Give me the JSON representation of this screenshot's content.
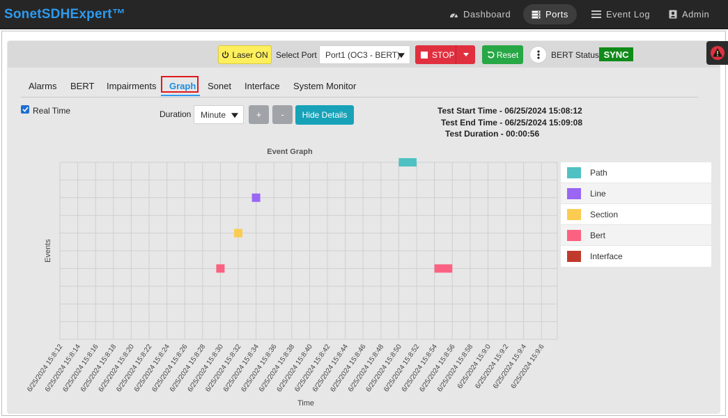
{
  "app": {
    "brand": "SonetSDHExpert™"
  },
  "nav": [
    {
      "label": "Dashboard",
      "icon": "dashboard-icon"
    },
    {
      "label": "Ports",
      "icon": "server-icon",
      "active": true
    },
    {
      "label": "Event Log",
      "icon": "list-icon"
    },
    {
      "label": "Admin",
      "icon": "user-icon"
    }
  ],
  "toolbar": {
    "laser_label": "Laser ON",
    "select_port_label": "Select Port",
    "port_value": "Port1 (OC3 - BERT)",
    "stop_label": "STOP",
    "reset_label": "Reset",
    "bert_status_label": "BERT Status",
    "bert_status_value": "SYNC"
  },
  "tabs": [
    "Alarms",
    "BERT",
    "Impairments",
    "Graph",
    "Sonet",
    "Interface",
    "System Monitor"
  ],
  "active_tab": "Graph",
  "controls": {
    "realtime_label": "Real Time",
    "realtime_checked": true,
    "duration_label": "Duration",
    "duration_value": "Minute",
    "plus_label": "+",
    "minus_label": "-",
    "hide_details_label": "Hide Details"
  },
  "details": {
    "start": "Test Start Time - 06/25/2024 15:08:12",
    "end": "Test End Time - 06/25/2024 15:09:08",
    "duration": "Test Duration - 00:00:56"
  },
  "colors": {
    "Path": "#4fc1c2",
    "Line": "#9a66f4",
    "Section": "#fccb51",
    "Bert": "#fb6282",
    "Interface": "#c1392b"
  },
  "chart_data": {
    "type": "scatter",
    "title": "Event Graph",
    "xlabel": "Time",
    "ylabel": "Events",
    "grid": true,
    "legend_placement": "right",
    "x_ticks": [
      "6/25/2024 15:8:12",
      "6/25/2024 15:8:14",
      "6/25/2024 15:8:16",
      "6/25/2024 15:8:18",
      "6/25/2024 15:8:20",
      "6/25/2024 15:8:22",
      "6/25/2024 15:8:24",
      "6/25/2024 15:8:26",
      "6/25/2024 15:8:28",
      "6/25/2024 15:8:30",
      "6/25/2024 15:8:32",
      "6/25/2024 15:8:34",
      "6/25/2024 15:8:36",
      "6/25/2024 15:8:38",
      "6/25/2024 15:8:40",
      "6/25/2024 15:8:42",
      "6/25/2024 15:8:44",
      "6/25/2024 15:8:46",
      "6/25/2024 15:8:48",
      "6/25/2024 15:8:50",
      "6/25/2024 15:8:52",
      "6/25/2024 15:8:54",
      "6/25/2024 15:8:56",
      "6/25/2024 15:8:58",
      "6/25/2024 15:9:0",
      "6/25/2024 15:9:2",
      "6/25/2024 15:9:4",
      "6/25/2024 15:9:6"
    ],
    "legend": [
      "Path",
      "Line",
      "Section",
      "Bert",
      "Interface"
    ],
    "series": [
      {
        "name": "Path",
        "points": [
          {
            "x": "6/25/2024 15:8:50",
            "x_end": "6/25/2024 15:8:52"
          }
        ]
      },
      {
        "name": "Line",
        "points": [
          {
            "x": "6/25/2024 15:8:34"
          }
        ]
      },
      {
        "name": "Section",
        "points": [
          {
            "x": "6/25/2024 15:8:32"
          }
        ]
      },
      {
        "name": "Bert",
        "points": [
          {
            "x": "6/25/2024 15:8:30"
          },
          {
            "x": "6/25/2024 15:8:54",
            "x_end": "6/25/2024 15:8:56"
          }
        ]
      },
      {
        "name": "Interface",
        "points": []
      }
    ]
  }
}
